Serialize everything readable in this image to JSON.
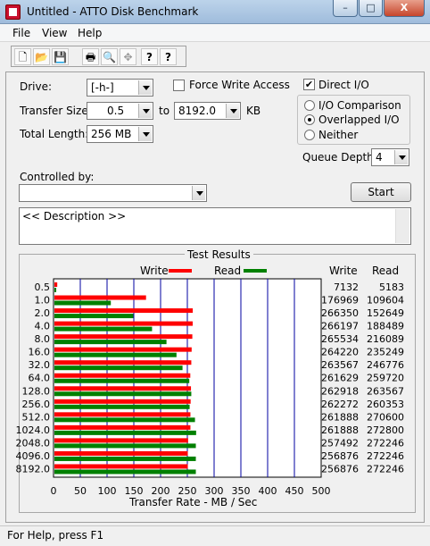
{
  "window": {
    "title": "Untitled - ATTO Disk Benchmark",
    "minimize_glyph": "–",
    "maximize_glyph": "□",
    "close_glyph": "X"
  },
  "menu": [
    "File",
    "View",
    "Help"
  ],
  "toolbar_icons": [
    "new-file-icon",
    "open-folder-icon",
    "save-icon",
    "print-icon",
    "print-preview-icon",
    "move-icon",
    "help-icon",
    "context-help-icon"
  ],
  "toolbar_glyphs": [
    "🗋",
    "📂",
    "💾",
    "🖶",
    "🔍",
    "✥",
    "?",
    "?"
  ],
  "drive": {
    "label": "Drive:",
    "value": "[-h-]"
  },
  "transfer_size": {
    "label": "Transfer Size:",
    "from": "0.5",
    "to_label": "to",
    "to": "8192.0",
    "unit": "KB"
  },
  "total_length": {
    "label": "Total Length:",
    "value": "256 MB"
  },
  "force_write_access": {
    "label": "Force Write Access",
    "checked": false
  },
  "direct_io": {
    "label": "Direct I/O",
    "checked": true,
    "check_glyph": "✔"
  },
  "io_mode": {
    "options": [
      "I/O Comparison",
      "Overlapped I/O",
      "Neither"
    ],
    "selected": "Overlapped I/O"
  },
  "queue_depth": {
    "label": "Queue Depth:",
    "value": "4"
  },
  "controlled_by": {
    "label": "Controlled by:",
    "value": ""
  },
  "start_button": "Start",
  "description": "<< Description >>",
  "status": "For Help, press F1",
  "colors": {
    "write": "#ff0000",
    "read": "#008000",
    "grid": "#0000a0"
  },
  "chart_data": {
    "type": "bar",
    "title": "Test Results",
    "legend": {
      "write": "Write",
      "read": "Read",
      "position": "top"
    },
    "table_headers": {
      "write": "Write",
      "read": "Read"
    },
    "xlabel": "Transfer Rate - MB / Sec",
    "xlim": [
      0,
      500
    ],
    "xticks": [
      "0",
      "50",
      "100",
      "150",
      "200",
      "250",
      "300",
      "350",
      "400",
      "450",
      "500"
    ],
    "categories": [
      "0.5",
      "1.0",
      "2.0",
      "4.0",
      "8.0",
      "16.0",
      "32.0",
      "64.0",
      "128.0",
      "256.0",
      "512.0",
      "1024.0",
      "2048.0",
      "4096.0",
      "8192.0"
    ],
    "series": [
      {
        "name": "Write",
        "values": [
          7132,
          176969,
          266350,
          266197,
          265534,
          264220,
          263567,
          261629,
          262918,
          262272,
          261888,
          261888,
          257492,
          256876,
          256876
        ]
      },
      {
        "name": "Read",
        "values": [
          5183,
          109604,
          152649,
          188489,
          216089,
          235249,
          246776,
          259720,
          263567,
          260353,
          270600,
          272800,
          272246,
          272246,
          272246
        ]
      }
    ]
  }
}
